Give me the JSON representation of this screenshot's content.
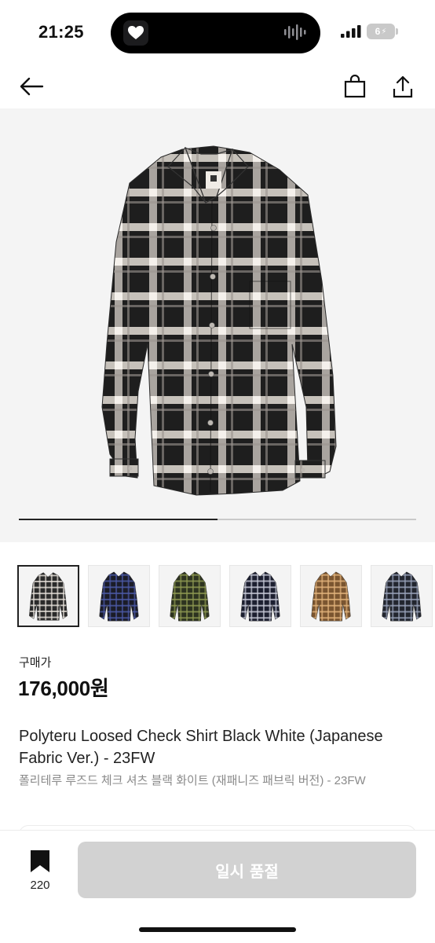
{
  "status_bar": {
    "time": "21:25",
    "battery": "6"
  },
  "nav": {
    "back_icon": "arrow-left-icon",
    "bag_icon": "shopping-bag-icon",
    "share_icon": "share-icon"
  },
  "gallery": {
    "progress": 0.5,
    "thumbnails": [
      {
        "color": "#2a2a2a",
        "light": "#e9e3dc"
      },
      {
        "color": "#1b1c27",
        "light": "#4c5aa8"
      },
      {
        "color": "#2d3320",
        "light": "#8f9a52"
      },
      {
        "color": "#1c1f30",
        "light": "#c9ccd9"
      },
      {
        "color": "#7a5530",
        "light": "#e3b47c"
      },
      {
        "color": "#22252e",
        "light": "#9aa4bb"
      }
    ]
  },
  "price": {
    "label": "구매가",
    "value": "176,000원"
  },
  "product": {
    "title_en": "Polyteru Loosed Check Shirt Black White (Japanese Fabric Ver.)  - 23FW",
    "title_ko": "폴리테루 루즈드 체크 셔츠 블랙 화이트 (재패니즈 패브릭 버전) - 23FW"
  },
  "bottom": {
    "wish_count": "220",
    "soldout_label": "일시 품절"
  }
}
